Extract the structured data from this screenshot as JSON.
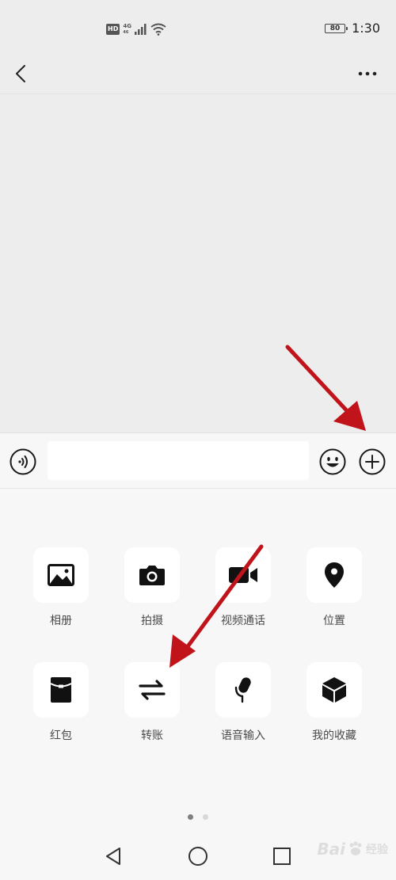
{
  "status_bar": {
    "hd_label": "HD",
    "network_label": "4G",
    "network_sub": "46",
    "battery_level": "80",
    "time": "1:30"
  },
  "nav": {
    "back_icon": "chevron-left-icon",
    "more_icon": "more-horizontal-icon"
  },
  "input_bar": {
    "message_value": "",
    "voice_icon": "voice-icon",
    "emoji_icon": "emoji-icon",
    "plus_icon": "plus-circle-icon"
  },
  "tools": [
    {
      "label": "相册",
      "icon": "image-icon"
    },
    {
      "label": "拍摄",
      "icon": "camera-icon"
    },
    {
      "label": "视频通话",
      "icon": "video-icon"
    },
    {
      "label": "位置",
      "icon": "location-icon"
    },
    {
      "label": "红包",
      "icon": "red-packet-icon"
    },
    {
      "label": "转账",
      "icon": "transfer-icon"
    },
    {
      "label": "语音输入",
      "icon": "microphone-icon"
    },
    {
      "label": "我的收藏",
      "icon": "cube-icon"
    }
  ],
  "pager": {
    "pages": 2,
    "active": 1
  },
  "watermark": {
    "brand": "Bai",
    "suffix": "经验"
  },
  "colors": {
    "annotation_arrow": "#c0141a",
    "panel_bg": "#f7f7f7",
    "chat_bg": "#ededed"
  }
}
